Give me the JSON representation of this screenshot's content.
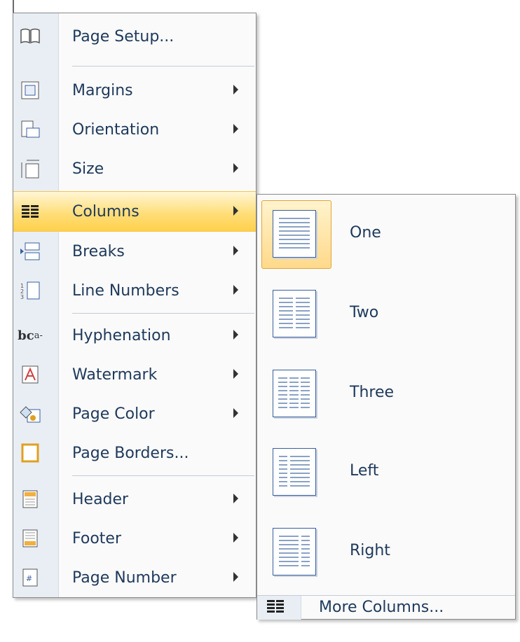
{
  "menu": {
    "items": [
      {
        "label": "Page Setup...",
        "icon": "page-setup-icon",
        "arrow": false
      },
      {
        "label": "Margins",
        "icon": "margins-icon",
        "arrow": true
      },
      {
        "label": "Orientation",
        "icon": "orientation-icon",
        "arrow": true
      },
      {
        "label": "Size",
        "icon": "size-icon",
        "arrow": true
      },
      {
        "label": "Columns",
        "icon": "columns-icon",
        "arrow": true,
        "highlighted": true
      },
      {
        "label": "Breaks",
        "icon": "breaks-icon",
        "arrow": true
      },
      {
        "label": "Line Numbers",
        "icon": "line-numbers-icon",
        "arrow": true
      },
      {
        "label": "Hyphenation",
        "icon": "hyphenation-icon",
        "arrow": true
      },
      {
        "label": "Watermark",
        "icon": "watermark-icon",
        "arrow": true
      },
      {
        "label": "Page Color",
        "icon": "page-color-icon",
        "arrow": true
      },
      {
        "label": "Page Borders...",
        "icon": "page-borders-icon",
        "arrow": false
      },
      {
        "label": "Header",
        "icon": "header-icon",
        "arrow": true
      },
      {
        "label": "Footer",
        "icon": "footer-icon",
        "arrow": true
      },
      {
        "label": "Page Number",
        "icon": "page-number-icon",
        "arrow": true
      }
    ],
    "hyphen_icon_text": "bc",
    "hyphen_icon_sup": "a-"
  },
  "columns_submenu": {
    "options": [
      {
        "label": "One",
        "selected": true
      },
      {
        "label": "Two",
        "selected": false
      },
      {
        "label": "Three",
        "selected": false
      },
      {
        "label": "Left",
        "selected": false
      },
      {
        "label": "Right",
        "selected": false
      }
    ],
    "more_label": "More Columns..."
  },
  "colors": {
    "highlight": "#ffd04a",
    "text": "#1e395b",
    "icon_blue": "#3a5f9e"
  }
}
